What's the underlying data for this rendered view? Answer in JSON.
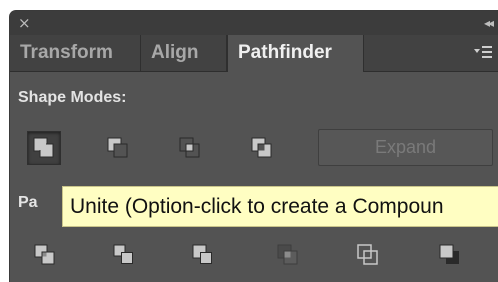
{
  "window": {
    "close_glyph": "×",
    "collapse_glyph": "◂◂"
  },
  "tabs": [
    {
      "label": "Transform",
      "active": false
    },
    {
      "label": "Align",
      "active": false
    },
    {
      "label": "Pathfinder",
      "active": true
    }
  ],
  "panel_menu_icon": "panel-menu-icon",
  "shape_modes": {
    "label": "Shape Modes:",
    "buttons": [
      {
        "name": "unite",
        "icon": "unite-icon",
        "active": true
      },
      {
        "name": "minus-front",
        "icon": "minus-front-icon",
        "active": false
      },
      {
        "name": "intersect",
        "icon": "intersect-icon",
        "active": false
      },
      {
        "name": "exclude",
        "icon": "exclude-icon",
        "active": false
      }
    ],
    "expand_label": "Expand",
    "expand_enabled": false
  },
  "pathfinders": {
    "label_visible": "Pa",
    "buttons": [
      {
        "name": "divide",
        "icon": "divide-icon"
      },
      {
        "name": "trim",
        "icon": "trim-icon"
      },
      {
        "name": "merge",
        "icon": "merge-icon"
      },
      {
        "name": "crop",
        "icon": "crop-icon"
      },
      {
        "name": "outline",
        "icon": "outline-icon"
      },
      {
        "name": "minus-back",
        "icon": "minus-back-icon"
      }
    ]
  },
  "tooltip": {
    "text": "Unite (Option-click to create a Compoun"
  },
  "colors": {
    "panel_bg": "#535353",
    "titlebar_bg": "#3c3c3c",
    "tabbar_bg": "#424242",
    "tooltip_bg": "#fffec2",
    "icon_light": "#c8c8c8",
    "icon_dark": "#2a2a2a"
  }
}
